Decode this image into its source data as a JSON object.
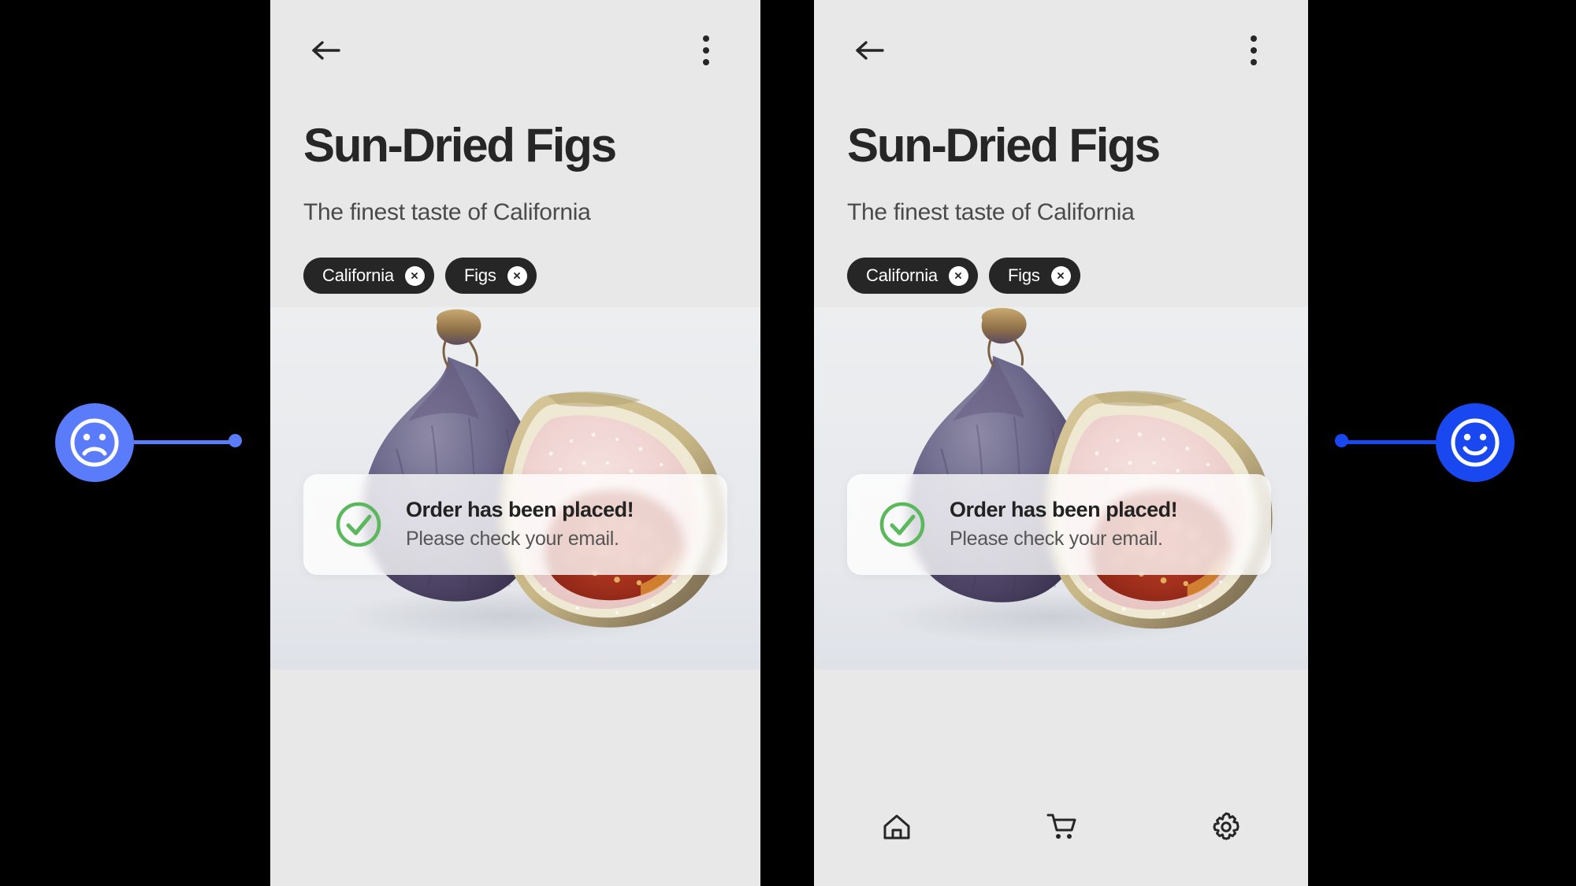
{
  "theme": {
    "panel_bg": "#e8e8e8",
    "page_bg": "#000000",
    "chip_bg": "#262626",
    "text_dark": "#262626",
    "text_muted": "#4a4a4a",
    "success_green": "#5cb85c",
    "marker_left_color": "#5b7cfa",
    "marker_right_color": "#1a48f0"
  },
  "screens": [
    {
      "id": "left",
      "topbar": {
        "back_icon": "arrow-left-icon",
        "menu_icon": "kebab-menu-icon"
      },
      "header": {
        "title": "Sun-Dried Figs",
        "subtitle": "The finest taste of California"
      },
      "chips": [
        {
          "label": "California",
          "close_icon": "close-icon"
        },
        {
          "label": "Figs",
          "close_icon": "close-icon"
        }
      ],
      "product_image": "sun-dried-figs-photo",
      "toast": {
        "icon": "check-circle-icon",
        "title": "Order has been placed!",
        "subtitle": "Please check your email."
      },
      "bottom_nav": {
        "visible": false,
        "items": []
      }
    },
    {
      "id": "right",
      "topbar": {
        "back_icon": "arrow-left-icon",
        "menu_icon": "kebab-menu-icon"
      },
      "header": {
        "title": "Sun-Dried Figs",
        "subtitle": "The finest taste of California"
      },
      "chips": [
        {
          "label": "California",
          "close_icon": "close-icon"
        },
        {
          "label": "Figs",
          "close_icon": "close-icon"
        }
      ],
      "product_image": "sun-dried-figs-photo",
      "toast": {
        "icon": "check-circle-icon",
        "title": "Order has been placed!",
        "subtitle": "Please check your email."
      },
      "bottom_nav": {
        "visible": true,
        "items": [
          {
            "icon": "home-icon"
          },
          {
            "icon": "shopping-cart-icon"
          },
          {
            "icon": "gear-icon"
          }
        ]
      }
    }
  ],
  "annotations": {
    "left_marker": {
      "icon": "sad-face-icon",
      "color": "#5b7cfa"
    },
    "right_marker": {
      "icon": "happy-face-icon",
      "color": "#1a48f0"
    }
  }
}
